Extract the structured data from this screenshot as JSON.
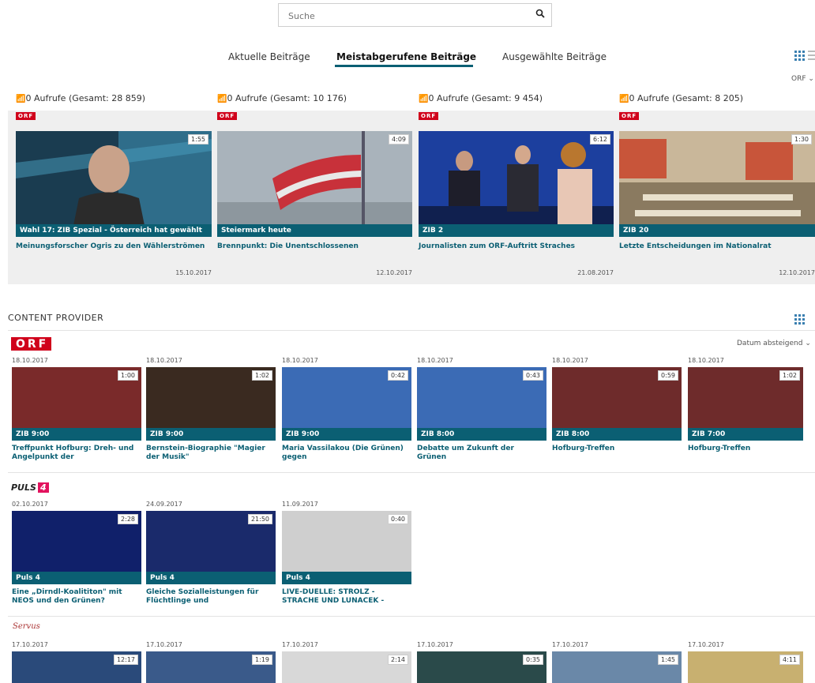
{
  "search": {
    "placeholder": "Suche"
  },
  "tabs": [
    {
      "label": "Aktuelle Beiträge"
    },
    {
      "label": "Meistabgerufene Beiträge"
    },
    {
      "label": "Ausgewählte Beiträge"
    }
  ],
  "top_right_label": "ORF",
  "most_viewed": [
    {
      "views": "0 Aufrufe (Gesamt: 28 859)",
      "provider": "ORF",
      "duration": "1:55",
      "show": "Wahl 17: ZIB Spezial - Österreich hat gewählt",
      "title": "Meinungsforscher Ogris zu den Wählerströmen",
      "date": "15.10.2017"
    },
    {
      "views": "0 Aufrufe (Gesamt: 10 176)",
      "provider": "ORF",
      "duration": "4:09",
      "show": "Steiermark heute",
      "title": "Brennpunkt: Die Unentschlossenen",
      "date": "12.10.2017"
    },
    {
      "views": "0 Aufrufe (Gesamt: 9 454)",
      "provider": "ORF",
      "duration": "6:12",
      "show": "ZIB 2",
      "title": "Journalisten zum ORF-Auftritt Straches",
      "date": "21.08.2017"
    },
    {
      "views": "0 Aufrufe (Gesamt: 8 205)",
      "provider": "ORF",
      "duration": "1:30",
      "show": "ZIB 20",
      "title": "Letzte Entscheidungen im Nationalrat",
      "date": "12.10.2017"
    }
  ],
  "content_provider": {
    "title": "CONTENT PROVIDER",
    "sort_label": "Datum absteigend",
    "orf": {
      "logo": "ORF",
      "items": [
        {
          "date": "18.10.2017",
          "duration": "1:00",
          "show": "ZIB 9:00",
          "title": "Treffpunkt Hofburg: Dreh- und Angelpunkt der"
        },
        {
          "date": "18.10.2017",
          "duration": "1:02",
          "show": "ZIB 9:00",
          "title": "Bernstein-Biographie \"Magier der Musik\""
        },
        {
          "date": "18.10.2017",
          "duration": "0:42",
          "show": "ZIB 9:00",
          "title": "Maria Vassilakou (Die Grünen) gegen"
        },
        {
          "date": "18.10.2017",
          "duration": "0:43",
          "show": "ZIB 8:00",
          "title": "Debatte um Zukunft der Grünen"
        },
        {
          "date": "18.10.2017",
          "duration": "0:59",
          "show": "ZIB 8:00",
          "title": "Hofburg-Treffen"
        },
        {
          "date": "18.10.2017",
          "duration": "1:02",
          "show": "ZIB 7:00",
          "title": "Hofburg-Treffen"
        }
      ]
    },
    "puls4": {
      "logo": "PULS",
      "logo_num": "4",
      "items": [
        {
          "date": "02.10.2017",
          "duration": "2:28",
          "show": "Puls 4",
          "title": "Eine „Dirndl-Koalititon\" mit NEOS und den Grünen?"
        },
        {
          "date": "24.09.2017",
          "duration": "21:50",
          "show": "Puls 4",
          "title": "Gleiche Sozialleistungen für Flüchtlinge und"
        },
        {
          "date": "11.09.2017",
          "duration": "0:40",
          "show": "Puls 4",
          "title": "LIVE-DUELLE: STROLZ - STRACHE UND LUNACEK -"
        }
      ]
    },
    "servus": {
      "logo": "Servus",
      "items": [
        {
          "date": "17.10.2017",
          "duration": "12:17"
        },
        {
          "date": "17.10.2017",
          "duration": "1:19"
        },
        {
          "date": "17.10.2017",
          "duration": "2:14"
        },
        {
          "date": "17.10.2017",
          "duration": "0:35"
        },
        {
          "date": "17.10.2017",
          "duration": "1:45"
        },
        {
          "date": "17.10.2017",
          "duration": "4:11"
        }
      ]
    }
  },
  "colors": {
    "accent": "#0b5f73",
    "orf_red": "#d0021b",
    "band": "#efefef"
  }
}
